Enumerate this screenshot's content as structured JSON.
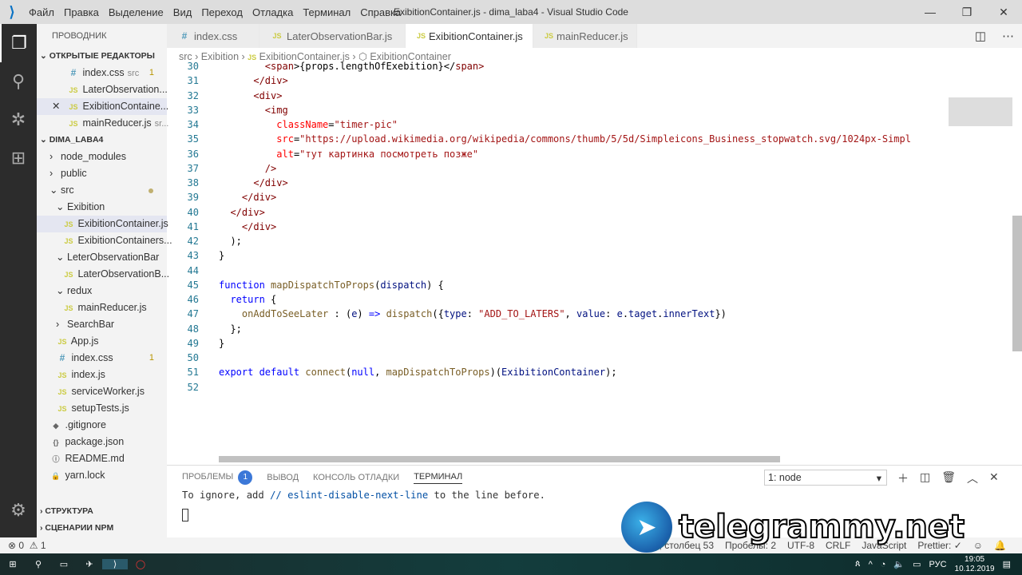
{
  "window": {
    "title": "ExibitionContainer.js - dima_laba4 - Visual Studio Code",
    "menu": [
      "Файл",
      "Правка",
      "Выделение",
      "Вид",
      "Переход",
      "Отладка",
      "Терминал",
      "Справка"
    ]
  },
  "sidebar": {
    "title": "ПРОВОДНИК",
    "open_editors_title": "ОТКРЫТЫЕ РЕДАКТОРЫ",
    "open_editors": [
      {
        "icon": "#",
        "name": "index.css",
        "hint": "src",
        "badge": "1"
      },
      {
        "icon": "JS",
        "name": "LaterObservation...",
        "hint": "",
        "badge": ""
      },
      {
        "icon": "JS",
        "name": "ExibitionContaine...",
        "hint": "",
        "badge": ""
      },
      {
        "icon": "JS",
        "name": "mainReducer.js",
        "hint": "sr...",
        "badge": ""
      }
    ],
    "project_title": "DIMA_LABA4",
    "tree": [
      {
        "t": "folder",
        "name": "node_modules",
        "d": 0,
        "open": false
      },
      {
        "t": "folder",
        "name": "public",
        "d": 0,
        "open": false
      },
      {
        "t": "folder",
        "name": "src",
        "d": 0,
        "open": true
      },
      {
        "t": "folder",
        "name": "Exibition",
        "d": 1,
        "open": true
      },
      {
        "t": "js",
        "name": "ExibitionContainer.js",
        "d": 2
      },
      {
        "t": "js",
        "name": "ExibitionContainers...",
        "d": 2
      },
      {
        "t": "folder",
        "name": "LeterObservationBar",
        "d": 1,
        "open": true
      },
      {
        "t": "js",
        "name": "LaterObservationB...",
        "d": 2
      },
      {
        "t": "folder",
        "name": "redux",
        "d": 1,
        "open": true
      },
      {
        "t": "js",
        "name": "mainReducer.js",
        "d": 2
      },
      {
        "t": "folder",
        "name": "SearchBar",
        "d": 1,
        "open": false
      },
      {
        "t": "js",
        "name": "App.js",
        "d": 1
      },
      {
        "t": "css",
        "name": "index.css",
        "d": 1,
        "badge": "1"
      },
      {
        "t": "js",
        "name": "index.js",
        "d": 1
      },
      {
        "t": "js",
        "name": "serviceWorker.js",
        "d": 1
      },
      {
        "t": "js",
        "name": "setupTests.js",
        "d": 1
      },
      {
        "t": "git",
        "name": ".gitignore",
        "d": 0
      },
      {
        "t": "json",
        "name": "package.json",
        "d": 0
      },
      {
        "t": "info",
        "name": "README.md",
        "d": 0
      },
      {
        "t": "lock",
        "name": "yarn.lock",
        "d": 0
      }
    ],
    "outline_title": "СТРУКТУРА",
    "npm_title": "СЦЕНАРИИ NPM"
  },
  "tabs": [
    {
      "icon": "#",
      "label": "index.css"
    },
    {
      "icon": "JS",
      "label": "LaterObservationBar.js"
    },
    {
      "icon": "JS",
      "label": "ExibitionContainer.js",
      "active": true
    },
    {
      "icon": "JS",
      "label": "mainReducer.js"
    }
  ],
  "breadcrumb": [
    "src",
    "Exibition",
    "ExibitionContainer.js",
    "ExibitionContainer"
  ],
  "code": [
    {
      "n": "30",
      "tok": [
        [
          "        ",
          "ws"
        ],
        [
          "<",
          "br"
        ],
        [
          "span",
          "tag"
        ],
        [
          ">{props.lengthOfExebition}</",
          "p"
        ],
        [
          "span",
          "tag"
        ],
        [
          ">",
          "br"
        ]
      ]
    },
    {
      "n": "31",
      "tok": [
        [
          "      </",
          "br"
        ],
        [
          "div",
          "tag"
        ],
        [
          ">",
          "br"
        ]
      ]
    },
    {
      "n": "32",
      "tok": [
        [
          "      <",
          "br"
        ],
        [
          "div",
          "tag"
        ],
        [
          ">",
          "br"
        ]
      ]
    },
    {
      "n": "33",
      "tok": [
        [
          "        <",
          "br"
        ],
        [
          "img",
          "tag"
        ]
      ]
    },
    {
      "n": "34",
      "tok": [
        [
          "          ",
          "ws"
        ],
        [
          "className",
          "jattr"
        ],
        [
          "=",
          "p"
        ],
        [
          "\"timer-pic\"",
          "str"
        ]
      ]
    },
    {
      "n": "35",
      "tok": [
        [
          "          ",
          "ws"
        ],
        [
          "src",
          "jattr"
        ],
        [
          "=",
          "p"
        ],
        [
          "\"https://upload.wikimedia.org/wikipedia/commons/thumb/5/5d/Simpleicons_Business_stopwatch.svg/1024px-Simpl",
          "str"
        ]
      ]
    },
    {
      "n": "36",
      "tok": [
        [
          "          ",
          "ws"
        ],
        [
          "alt",
          "jattr"
        ],
        [
          "=",
          "p"
        ],
        [
          "\"тут картинка посмотреть позже\"",
          "str"
        ]
      ]
    },
    {
      "n": "37",
      "tok": [
        [
          "        />",
          "br"
        ]
      ]
    },
    {
      "n": "38",
      "tok": [
        [
          "      </",
          "br"
        ],
        [
          "div",
          "tag"
        ],
        [
          ">",
          "br"
        ]
      ]
    },
    {
      "n": "39",
      "tok": [
        [
          "    </",
          "br"
        ],
        [
          "div",
          "tag"
        ],
        [
          ">",
          "br"
        ]
      ]
    },
    {
      "n": "40",
      "tok": [
        [
          "  </",
          "br"
        ],
        [
          "div",
          "tag"
        ],
        [
          ">",
          "br"
        ]
      ]
    },
    {
      "n": "41",
      "tok": [
        [
          "    </",
          "br"
        ],
        [
          "div",
          "tag"
        ],
        [
          ">",
          "br"
        ]
      ]
    },
    {
      "n": "42",
      "tok": [
        [
          "  );",
          "p"
        ]
      ]
    },
    {
      "n": "43",
      "tok": [
        [
          "}",
          "p"
        ]
      ]
    },
    {
      "n": "44",
      "tok": []
    },
    {
      "n": "45",
      "tok": [
        [
          "function ",
          "kw"
        ],
        [
          "mapDispatchToProps",
          "fn"
        ],
        [
          "(",
          "p"
        ],
        [
          "dispatch",
          "var"
        ],
        [
          ") {",
          "p"
        ]
      ]
    },
    {
      "n": "46",
      "tok": [
        [
          "  ",
          "ws"
        ],
        [
          "return",
          "kw"
        ],
        [
          " {",
          "p"
        ]
      ]
    },
    {
      "n": "47",
      "tok": [
        [
          "    ",
          "ws"
        ],
        [
          "onAddToSeeLater",
          "fn"
        ],
        [
          " : (",
          "p"
        ],
        [
          "e",
          "var"
        ],
        [
          ") ",
          "p"
        ],
        [
          "=>",
          "kw"
        ],
        [
          " ",
          "p"
        ],
        [
          "dispatch",
          "fn"
        ],
        [
          "({",
          "p"
        ],
        [
          "type",
          "var"
        ],
        [
          ": ",
          "p"
        ],
        [
          "\"ADD_TO_LATERS\"",
          "str"
        ],
        [
          ", ",
          "p"
        ],
        [
          "value",
          "var"
        ],
        [
          ": ",
          "p"
        ],
        [
          "e",
          "var"
        ],
        [
          ".",
          "p"
        ],
        [
          "taget",
          "var"
        ],
        [
          ".",
          "p"
        ],
        [
          "innerText",
          "var"
        ],
        [
          "})",
          "p"
        ]
      ]
    },
    {
      "n": "48",
      "tok": [
        [
          "  };",
          "p"
        ]
      ]
    },
    {
      "n": "49",
      "tok": [
        [
          "}",
          "p"
        ]
      ]
    },
    {
      "n": "50",
      "tok": []
    },
    {
      "n": "51",
      "tok": [
        [
          "export ",
          "kw"
        ],
        [
          "default ",
          "kw"
        ],
        [
          "connect",
          "fn"
        ],
        [
          "(",
          "p"
        ],
        [
          "null",
          "kw"
        ],
        [
          ", ",
          "p"
        ],
        [
          "mapDispatchToProps",
          "fn"
        ],
        [
          ")(",
          "p"
        ],
        [
          "ExibitionContainer",
          "var"
        ],
        [
          ");",
          "p"
        ]
      ]
    },
    {
      "n": "52",
      "tok": []
    }
  ],
  "panel": {
    "tabs": [
      "ПРОБЛЕМЫ",
      "ВЫВОД",
      "КОНСОЛЬ ОТЛАДКИ",
      "ТЕРМИНАЛ"
    ],
    "problems_count": "1",
    "terminal_select": "1: node",
    "terminal_line": {
      "a": "To ignore, add ",
      "b": "// eslint-disable-next-line",
      "c": " to the line before."
    }
  },
  "status": {
    "errors": "0",
    "warnings": "1",
    "position": "11, столбец 53",
    "spaces": "Пробелы: 2",
    "encoding": "UTF-8",
    "eol": "CRLF",
    "language": "JavaScript",
    "prettier": "Prettier: ✓"
  },
  "taskbar": {
    "lang": "РУС",
    "time": "19:05",
    "date": "10.12.2019"
  },
  "watermark": "telegrammy.net"
}
